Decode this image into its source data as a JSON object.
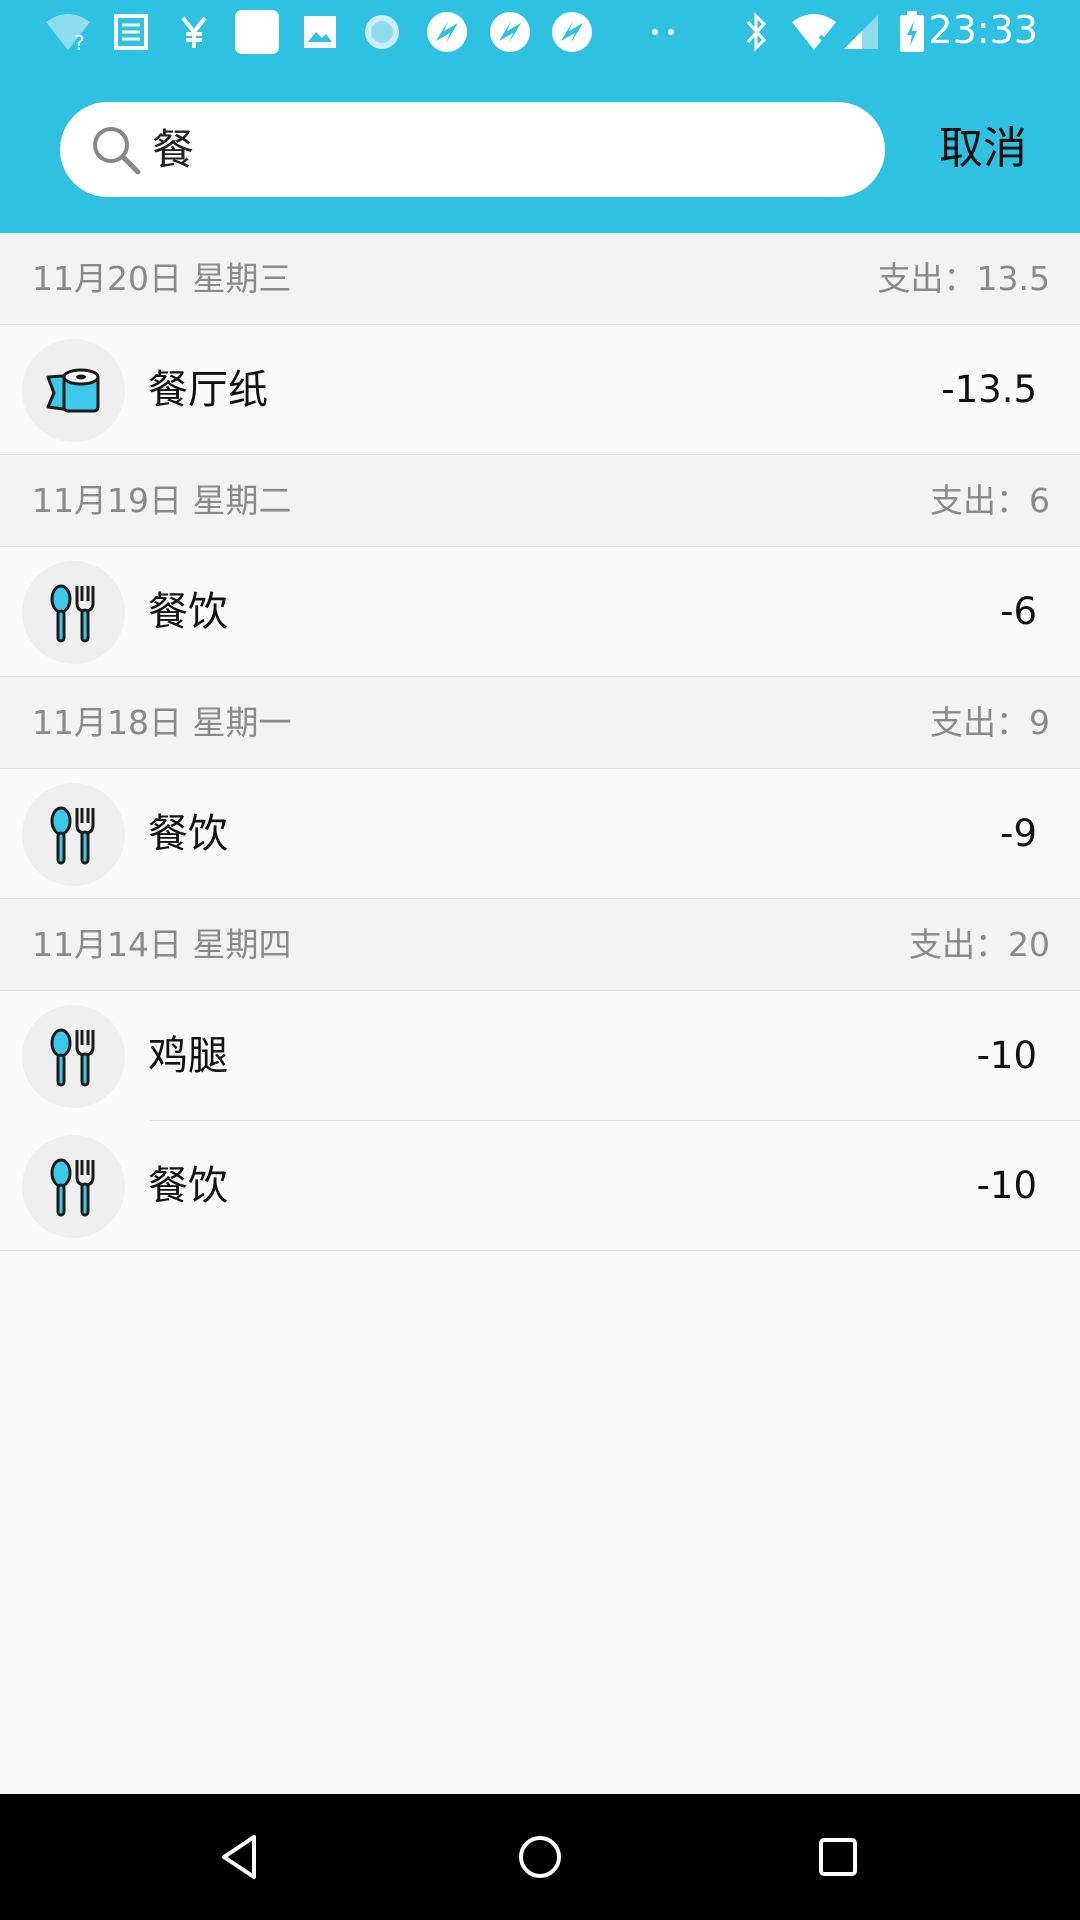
{
  "status_bar": {
    "time": "23:33",
    "icons": [
      "wifi-question-icon",
      "news-icon",
      "yen-icon",
      "square-icon",
      "image-icon",
      "loading-icon",
      "app-icon",
      "app-icon",
      "app-icon",
      "more-dots-icon",
      "bluetooth-icon",
      "wifi-x-icon",
      "signal-icon",
      "battery-charging-icon"
    ]
  },
  "search": {
    "query": "餐",
    "cancel_label": "取消"
  },
  "colors": {
    "accent": "#2fc1e1",
    "icon_fill": "#3cc8e8"
  },
  "groups": [
    {
      "date": "11月20日  星期三",
      "total": "支出：13.5",
      "items": [
        {
          "icon": "toilet-paper-icon",
          "label": "餐厅纸",
          "amount": "-13.5"
        }
      ]
    },
    {
      "date": "11月19日  星期二",
      "total": "支出：6",
      "items": [
        {
          "icon": "utensils-icon",
          "label": "餐饮",
          "amount": "-6"
        }
      ]
    },
    {
      "date": "11月18日  星期一",
      "total": "支出：9",
      "items": [
        {
          "icon": "utensils-icon",
          "label": "餐饮",
          "amount": "-9"
        }
      ]
    },
    {
      "date": "11月14日  星期四",
      "total": "支出：20",
      "items": [
        {
          "icon": "utensils-icon",
          "label": "鸡腿",
          "amount": "-10"
        },
        {
          "icon": "utensils-icon",
          "label": "餐饮",
          "amount": "-10"
        }
      ]
    }
  ],
  "nav": {
    "icons": [
      "back-icon",
      "home-icon",
      "recents-icon"
    ]
  }
}
